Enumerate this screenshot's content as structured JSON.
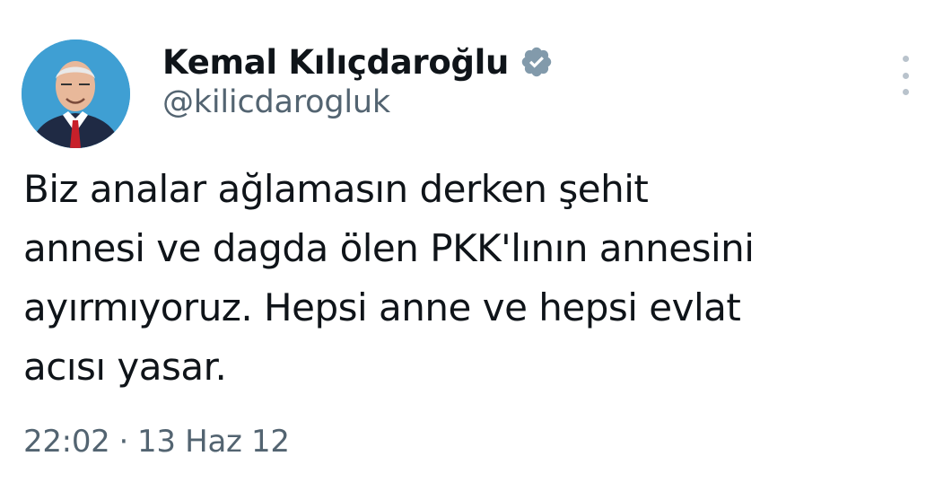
{
  "author": {
    "name": "Kemal Kılıçdaroğlu",
    "handle": "@kilicdarogluk",
    "verified": true,
    "avatar_icon": "profile-photo"
  },
  "tweet": {
    "lines": [
      "Biz analar ağlamasın derken şehit",
      "annesi ve dagda ölen PKK'lının annesini",
      "ayırmıyoruz. Hepsi anne ve hepsi evlat",
      "acısı yasar."
    ],
    "time": "22:02",
    "separator": "·",
    "date": "13 Haz 12"
  },
  "icons": {
    "verified": "verified-badge-icon",
    "more": "more-options-icon"
  },
  "colors": {
    "text": "#0f1419",
    "secondary": "#536471",
    "verified_badge": "#829aab",
    "avatar_bg": "#3f9fd3"
  }
}
